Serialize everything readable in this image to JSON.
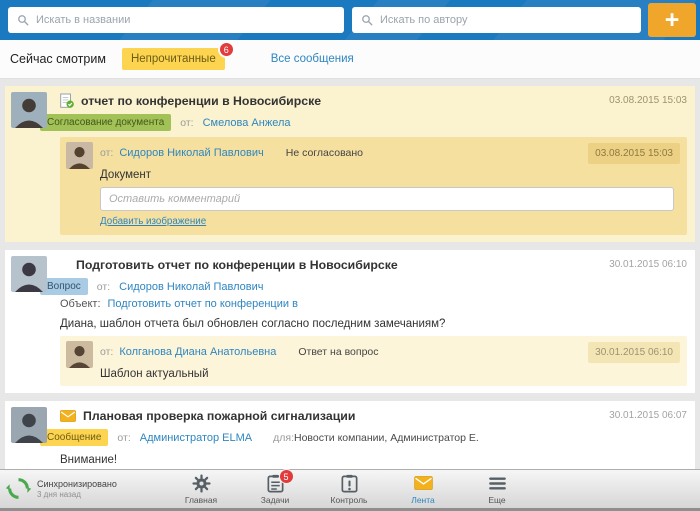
{
  "colors": {
    "topbar_blue": "#1b79c0",
    "accent_orange": "#f0a62a",
    "link_blue": "#2e86c1",
    "unread_yellow": "#fcd44f",
    "badge_red": "#e23b3b",
    "approval_green": "#a2c258",
    "question_blue": "#a9cbe4",
    "sync_green": "#49a94e",
    "unread_card_bg": "#fbf2cf",
    "unread_nested_bg": "#f5e0a0"
  },
  "topbar": {
    "search_title_placeholder": "Искать в названии",
    "search_author_placeholder": "Искать по автору",
    "add_button_label": "+"
  },
  "filterbar": {
    "watching_label": "Сейчас смотрим",
    "unread_tab": "Непрочитанные",
    "unread_count": "6",
    "all_tab": "Все сообщения"
  },
  "feed": {
    "approval": {
      "title": "отчет по конференции в Новосибирске",
      "date": "03.08.2015 15:03",
      "badge": "Согласование документа",
      "from_label": "от:",
      "author": "Смелова Анжела",
      "comment": {
        "from_label": "от:",
        "author": "Сидоров Николай Павлович",
        "status": "Не согласовано",
        "date": "03.08.2015 15:03",
        "text": "Документ"
      },
      "comment_placeholder": "Оставить комментарий",
      "add_image_label": "Добавить изображение"
    },
    "question": {
      "title": "Подготовить отчет по конференции в Новосибирске",
      "date": "30.01.2015 06:10",
      "badge": "Вопрос",
      "from_label": "от:",
      "author": "Сидоров Николай Павлович",
      "object_label": "Объект:",
      "object_value": "Подготовить отчет по конференции в",
      "text": "Диана, шаблон отчета был обновлен согласно последним замечаниям?",
      "reply": {
        "from_label": "от:",
        "author": "Колганова Диана Анатольевна",
        "kind": "Ответ на вопрос",
        "date": "30.01.2015 06:10",
        "text": "Шаблон актуальный"
      }
    },
    "announcement": {
      "title": "Плановая проверка пожарной сигнализации",
      "date": "30.01.2015 06:07",
      "badge": "Сообщение",
      "from_label": "от:",
      "author": "Администратор ELMA",
      "to_label": "для:",
      "to_value": "Новости компании, Администратор Е.",
      "text": "Внимание!"
    }
  },
  "bottombar": {
    "sync_status": "Синхронизировано",
    "sync_time": "3 дня назад",
    "nav": [
      {
        "label": "Главная"
      },
      {
        "label": "Задачи",
        "badge": "5"
      },
      {
        "label": "Контроль"
      },
      {
        "label": "Лента"
      },
      {
        "label": "Еще"
      }
    ]
  }
}
